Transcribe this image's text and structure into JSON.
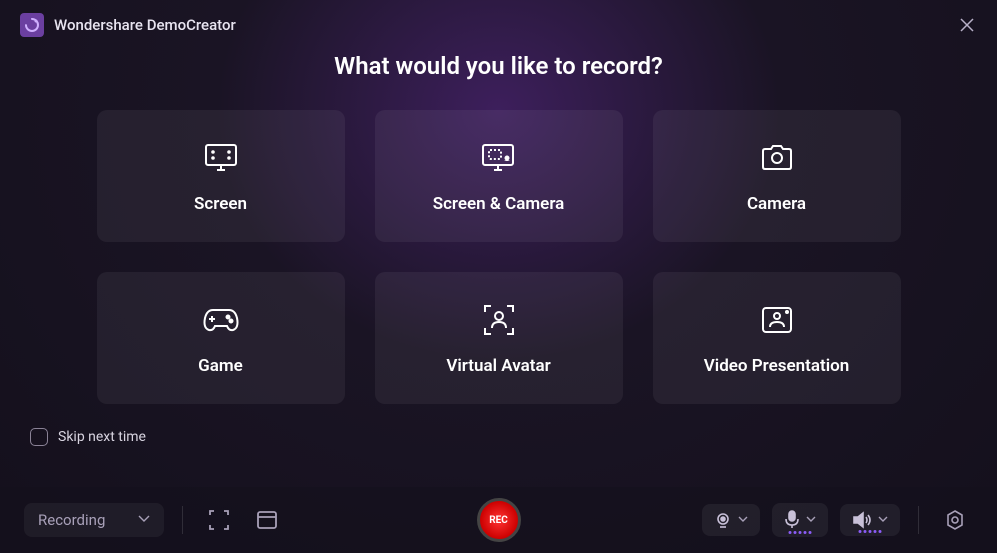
{
  "app": {
    "title": "Wondershare DemoCreator"
  },
  "main": {
    "heading": "What would you like to record?",
    "options": [
      {
        "label": "Screen"
      },
      {
        "label": "Screen & Camera"
      },
      {
        "label": "Camera"
      },
      {
        "label": "Game"
      },
      {
        "label": "Virtual Avatar"
      },
      {
        "label": "Video Presentation"
      }
    ]
  },
  "skip": {
    "label": "Skip next time",
    "checked": false
  },
  "bottombar": {
    "mode": "Recording",
    "record_label": "REC"
  }
}
